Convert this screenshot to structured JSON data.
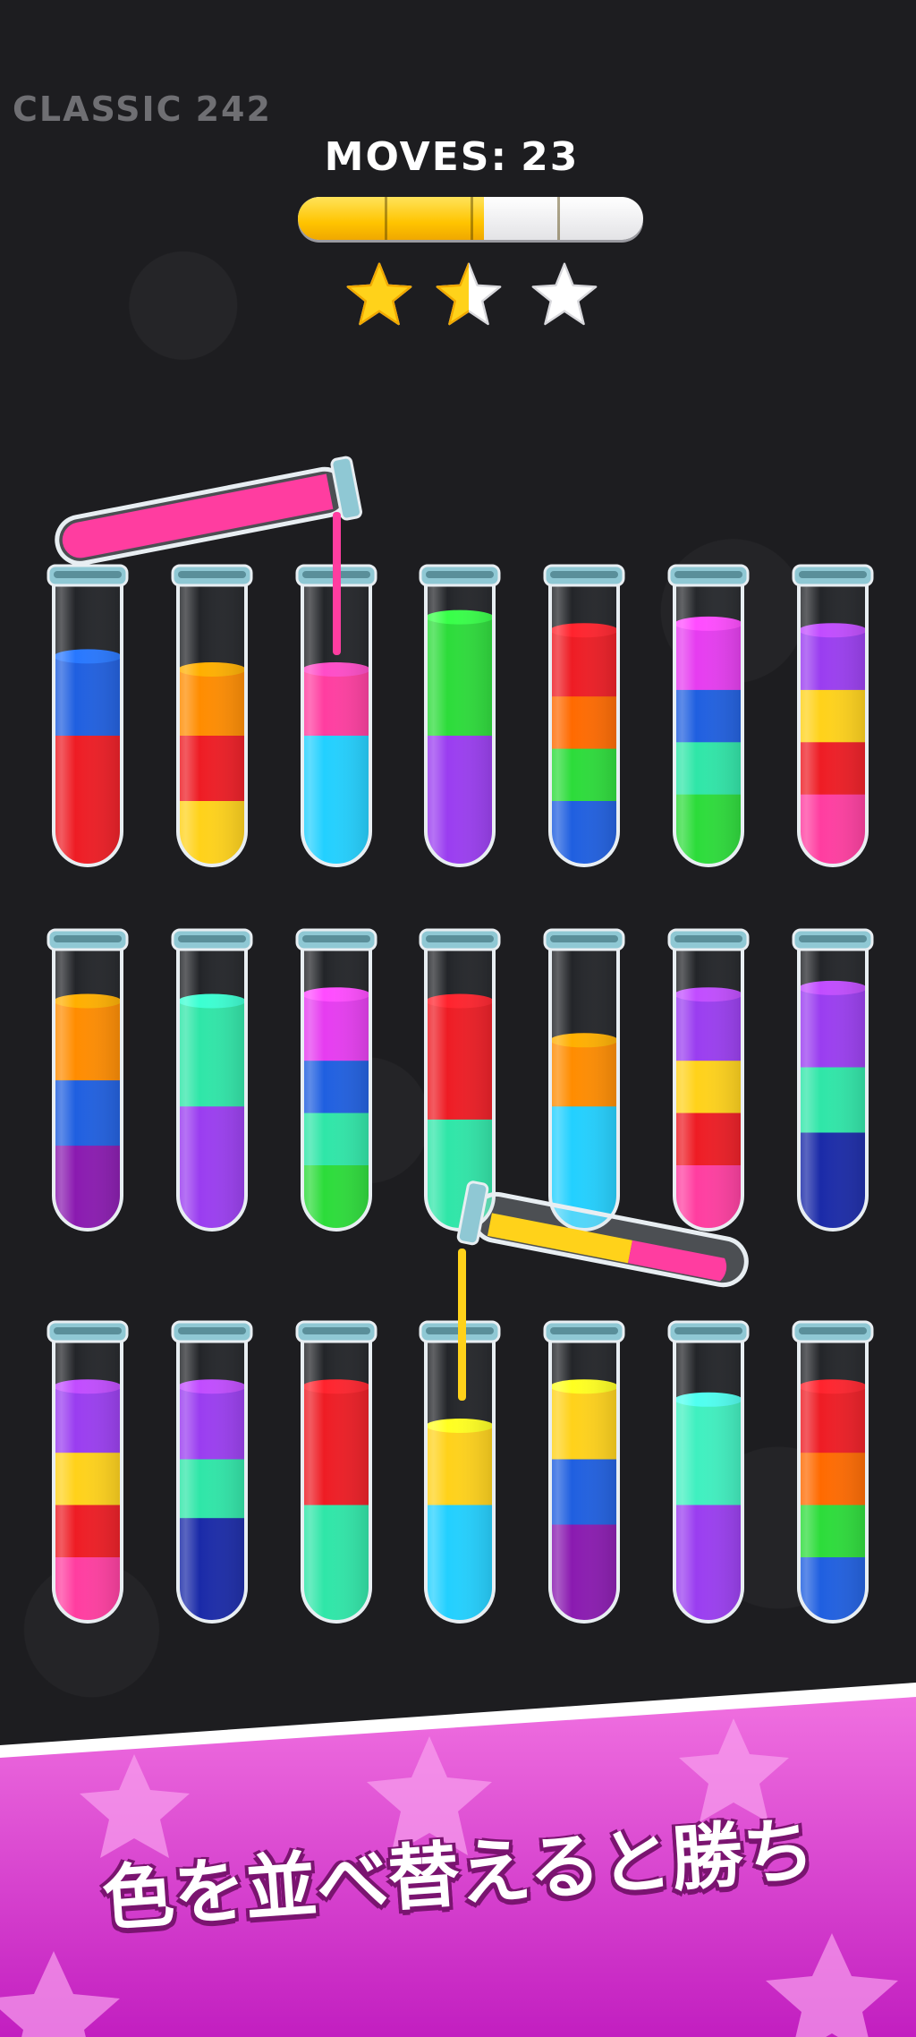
{
  "header": {
    "mode": "CLASSIC",
    "level": "242",
    "moves_label": "MOVES:",
    "moves_value": "23"
  },
  "progress": {
    "fill": 0.54,
    "segments": 4
  },
  "stars": {
    "levels": [
      1,
      0.5,
      0
    ],
    "gold": "#ffd21a",
    "empty": "#ffffff"
  },
  "colors": {
    "red": "#ee1c24",
    "blue": "#1f5fe0",
    "yellow": "#ffd21a",
    "orange": "#ff8c00",
    "pink": "#ff3da0",
    "cyan": "#22d0ff",
    "green": "#2cdc3a",
    "purple": "#9a3df0",
    "magenta": "#e63cf0",
    "teal": "#2fe6a8",
    "navy": "#1a2aa8",
    "darkpurple": "#8a1ab0",
    "deeporange": "#ff6a00",
    "mint": "#3ff0c0"
  },
  "tubes": [
    {
      "row": 0,
      "col": 0,
      "layers": [
        "red",
        "blue"
      ],
      "units": [
        2,
        1.2
      ]
    },
    {
      "row": 0,
      "col": 1,
      "layers": [
        "yellow",
        "red",
        "orange"
      ],
      "units": [
        1,
        1,
        1
      ]
    },
    {
      "row": 0,
      "col": 2,
      "layers": [
        "cyan",
        "pink"
      ],
      "units": [
        2,
        1
      ]
    },
    {
      "row": 0,
      "col": 3,
      "layers": [
        "purple",
        "green"
      ],
      "units": [
        2,
        1.8
      ]
    },
    {
      "row": 0,
      "col": 4,
      "layers": [
        "blue",
        "green",
        "deeporange",
        "red"
      ],
      "units": [
        1,
        0.8,
        0.8,
        1
      ]
    },
    {
      "row": 0,
      "col": 5,
      "layers": [
        "green",
        "teal",
        "blue",
        "magenta"
      ],
      "units": [
        1.1,
        0.8,
        0.8,
        1
      ]
    },
    {
      "row": 0,
      "col": 6,
      "layers": [
        "pink",
        "red",
        "yellow",
        "purple"
      ],
      "units": [
        1.1,
        0.8,
        0.8,
        0.9
      ]
    },
    {
      "row": 1,
      "col": 0,
      "layers": [
        "darkpurple",
        "blue",
        "orange"
      ],
      "units": [
        1.3,
        1,
        1.2
      ]
    },
    {
      "row": 1,
      "col": 1,
      "layers": [
        "purple",
        "teal"
      ],
      "units": [
        1.9,
        1.6
      ]
    },
    {
      "row": 1,
      "col": 2,
      "layers": [
        "green",
        "teal",
        "blue",
        "magenta"
      ],
      "units": [
        1,
        0.8,
        0.8,
        1
      ]
    },
    {
      "row": 1,
      "col": 3,
      "layers": [
        "teal",
        "red"
      ],
      "units": [
        1.7,
        1.8
      ]
    },
    {
      "row": 1,
      "col": 4,
      "layers": [
        "cyan",
        "orange"
      ],
      "units": [
        1.9,
        1
      ]
    },
    {
      "row": 1,
      "col": 5,
      "layers": [
        "pink",
        "red",
        "yellow",
        "purple"
      ],
      "units": [
        1,
        0.8,
        0.8,
        1
      ]
    },
    {
      "row": 1,
      "col": 6,
      "layers": [
        "navy",
        "teal",
        "purple"
      ],
      "units": [
        1.5,
        1,
        1.2
      ]
    },
    {
      "row": 2,
      "col": 0,
      "layers": [
        "pink",
        "red",
        "yellow",
        "purple"
      ],
      "units": [
        1,
        0.8,
        0.8,
        1
      ]
    },
    {
      "row": 2,
      "col": 1,
      "layers": [
        "navy",
        "teal",
        "purple"
      ],
      "units": [
        1.6,
        0.9,
        1.1
      ]
    },
    {
      "row": 2,
      "col": 2,
      "layers": [
        "teal",
        "red"
      ],
      "units": [
        1.8,
        1.8
      ]
    },
    {
      "row": 2,
      "col": 3,
      "layers": [
        "cyan",
        "yellow"
      ],
      "units": [
        1.8,
        1.2
      ]
    },
    {
      "row": 2,
      "col": 4,
      "layers": [
        "darkpurple",
        "blue",
        "yellow"
      ],
      "units": [
        1.5,
        1,
        1.1
      ]
    },
    {
      "row": 2,
      "col": 5,
      "layers": [
        "purple",
        "mint"
      ],
      "units": [
        1.8,
        1.6
      ]
    },
    {
      "row": 2,
      "col": 6,
      "layers": [
        "blue",
        "green",
        "deeporange",
        "red"
      ],
      "units": [
        1,
        0.8,
        0.8,
        1
      ]
    }
  ],
  "pouring": [
    {
      "color": "pink",
      "into": "tube-0-2"
    },
    {
      "color": "yellow",
      "into": "tube-2-3",
      "second": "pink"
    }
  ],
  "banner": {
    "text": "色を並べ替えると勝ち",
    "gradient": [
      "#f070e0",
      "#c21ec0"
    ],
    "star_color": "#f8a0ee"
  }
}
